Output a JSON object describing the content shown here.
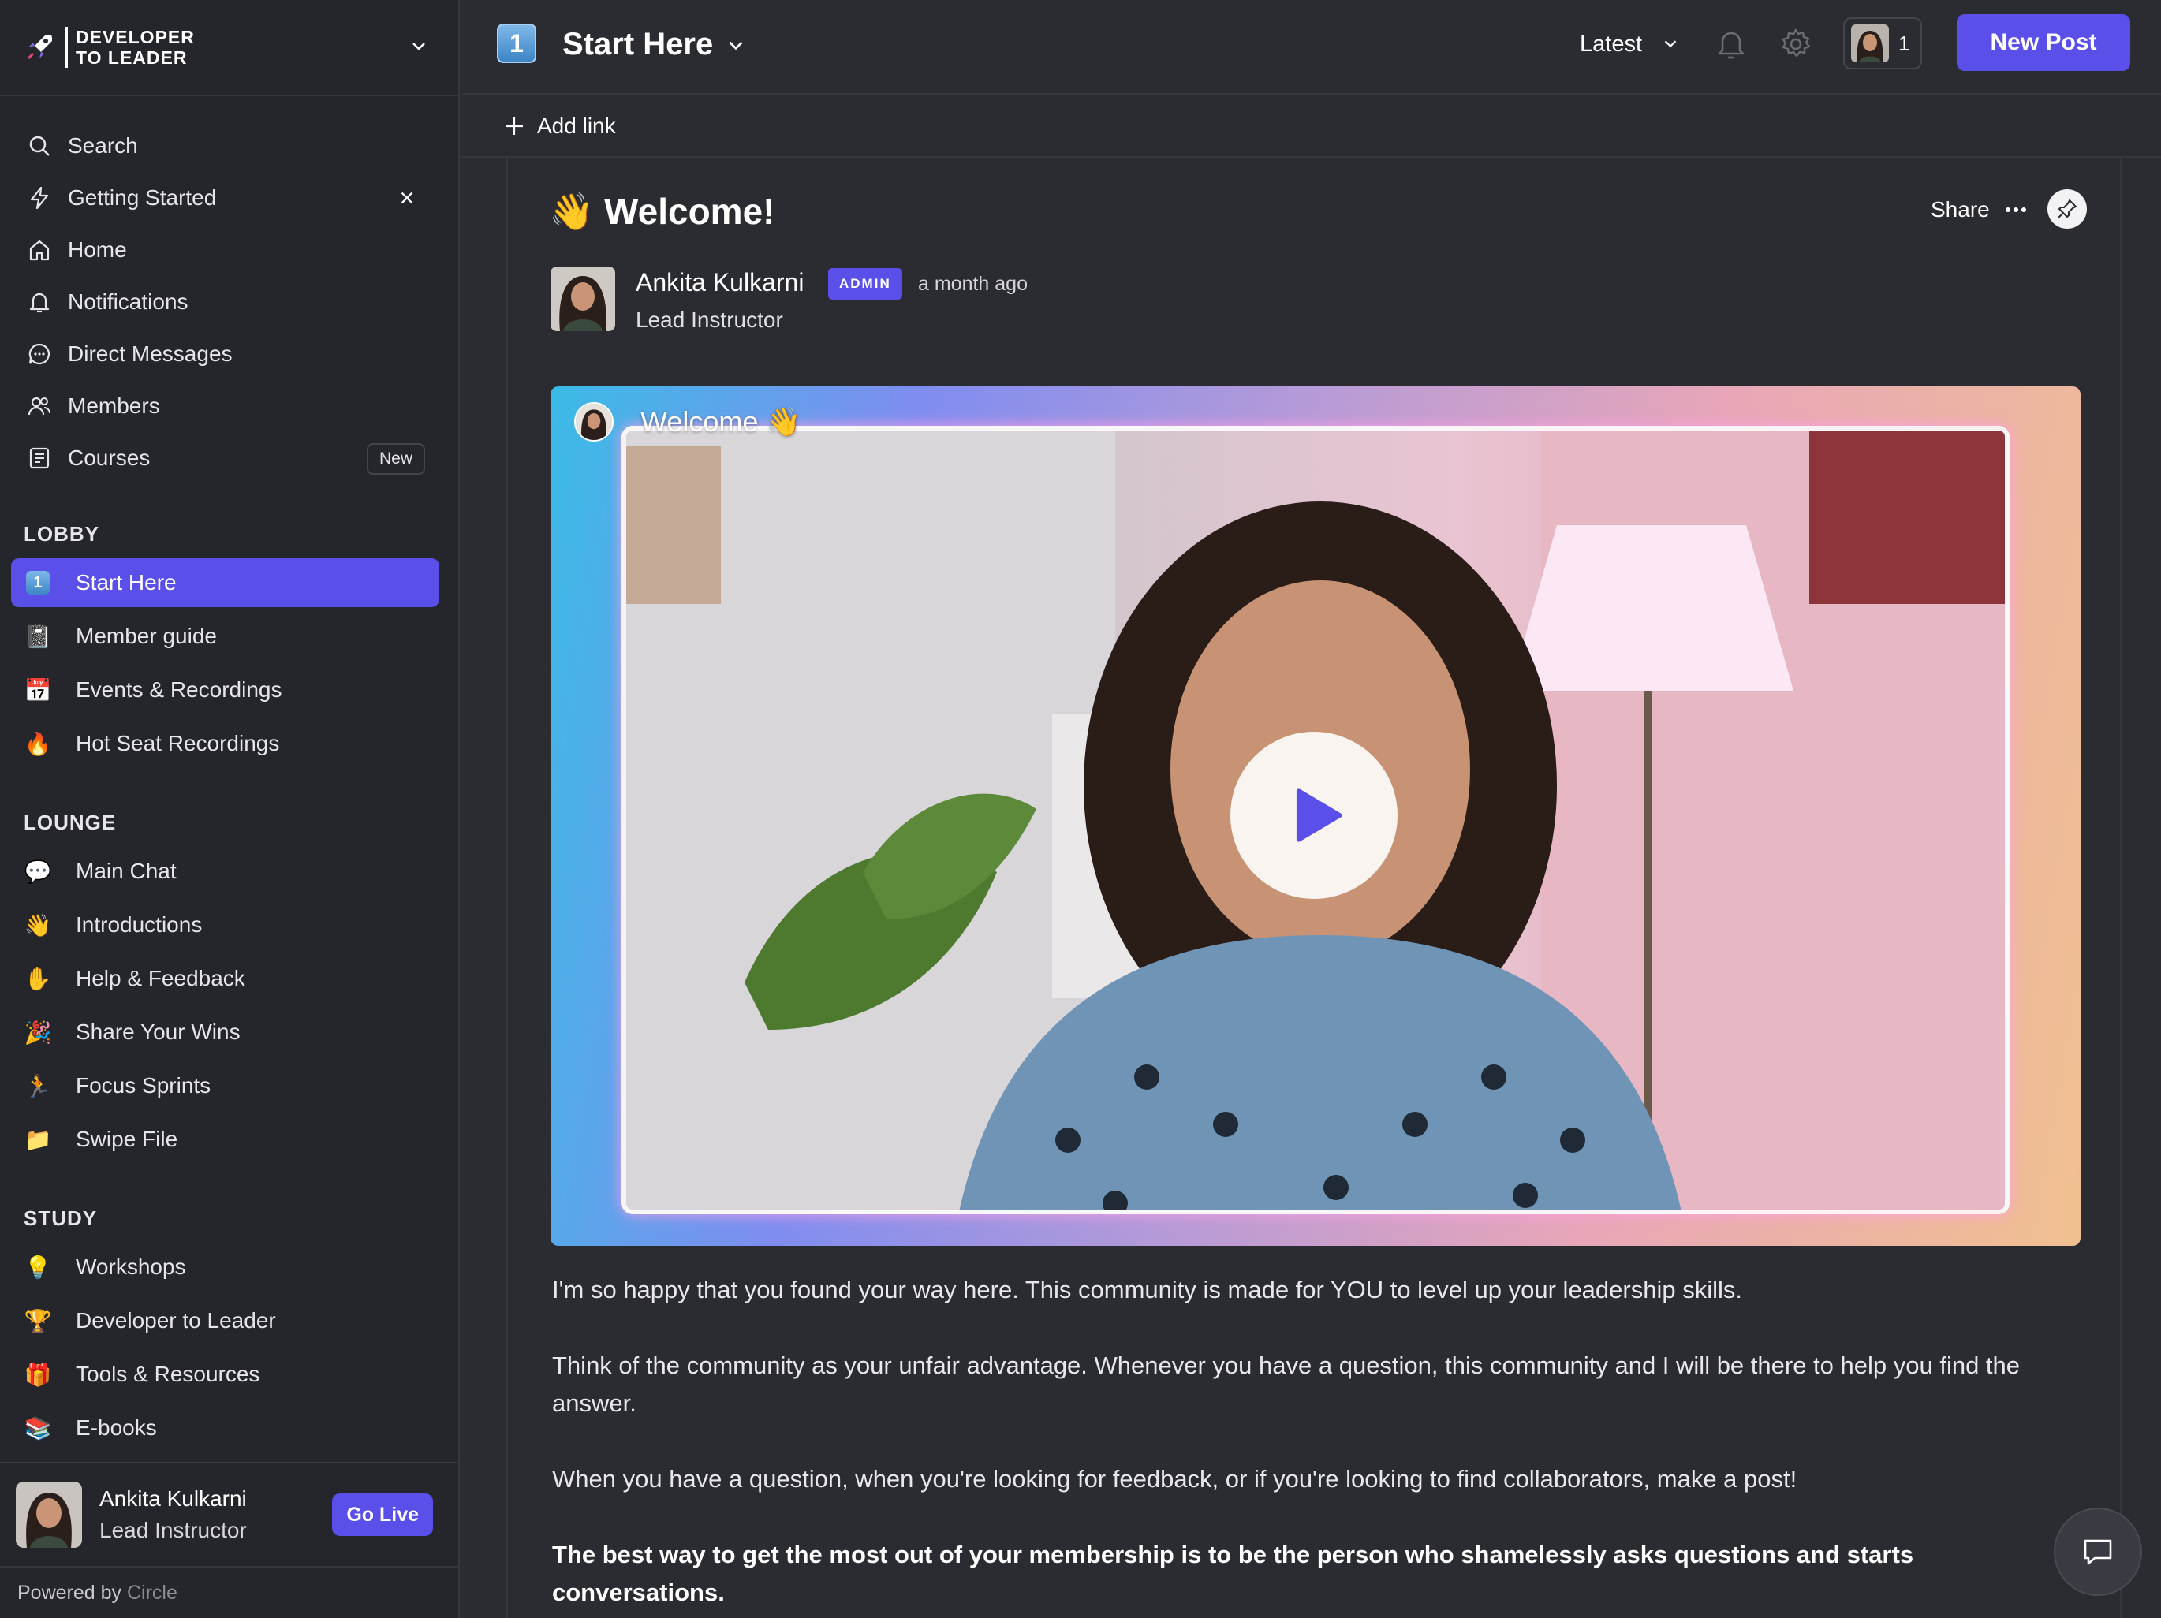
{
  "brand": {
    "line1": "DEVELOPER",
    "line2": "TO LEADER"
  },
  "sidebar": {
    "nav": [
      {
        "label": "Search",
        "icon": "search-icon"
      },
      {
        "label": "Getting Started",
        "icon": "bolt-icon"
      },
      {
        "label": "Home",
        "icon": "home-icon"
      },
      {
        "label": "Notifications",
        "icon": "bell-icon"
      },
      {
        "label": "Direct Messages",
        "icon": "chat-bubble-icon"
      },
      {
        "label": "Members",
        "icon": "members-icon"
      },
      {
        "label": "Courses",
        "icon": "courses-icon",
        "badge": "New"
      }
    ],
    "sections": [
      {
        "title": "LOBBY",
        "items": [
          {
            "label": "Start Here",
            "emoji": "1",
            "active": true
          },
          {
            "label": "Member guide",
            "emoji": "📓"
          },
          {
            "label": "Events & Recordings",
            "emoji": "📅"
          },
          {
            "label": "Hot Seat Recordings",
            "emoji": "🔥"
          }
        ]
      },
      {
        "title": "LOUNGE",
        "items": [
          {
            "label": "Main Chat",
            "emoji": "💬"
          },
          {
            "label": "Introductions",
            "emoji": "👋"
          },
          {
            "label": "Help & Feedback",
            "emoji": "✋"
          },
          {
            "label": "Share Your Wins",
            "emoji": "🎉"
          },
          {
            "label": "Focus Sprints",
            "emoji": "🏃"
          },
          {
            "label": "Swipe File",
            "emoji": "📁"
          }
        ]
      },
      {
        "title": "STUDY",
        "items": [
          {
            "label": "Workshops",
            "emoji": "💡"
          },
          {
            "label": "Developer to Leader",
            "emoji": "🏆"
          },
          {
            "label": "Tools & Resources",
            "emoji": "🎁"
          },
          {
            "label": "E-books",
            "emoji": "📚"
          }
        ]
      }
    ],
    "user": {
      "name": "Ankita Kulkarni",
      "role": "Lead Instructor",
      "go_live": "Go Live"
    },
    "powered_prefix": "Powered by",
    "powered_brand": "Circle"
  },
  "header": {
    "space_icon_text": "1",
    "title": "Start Here",
    "sort": "Latest",
    "member_count": "1",
    "new_post": "New Post",
    "add_link": "Add link"
  },
  "post": {
    "title": "👋 Welcome!",
    "share": "Share",
    "author": "Ankita Kulkarni",
    "admin_badge": "ADMIN",
    "time": "a month ago",
    "role": "Lead Instructor",
    "video_title": "Welcome 👋",
    "paragraphs": [
      "I'm so happy that you found your way here. This community is made for YOU to level up your leadership skills.",
      "Think of the community as your unfair advantage. Whenever you have a question, this community and I will be there to help you find the answer.",
      "When you have a question, when you're looking for feedback, or if you're looking to find collaborators, make a post!",
      "The best way to get the most out of your membership is to be the person who shamelessly asks questions and starts conversations."
    ]
  },
  "colors": {
    "accent": "#5a4fe8",
    "background": "#2b2c31",
    "sidebar": "#25262b"
  }
}
